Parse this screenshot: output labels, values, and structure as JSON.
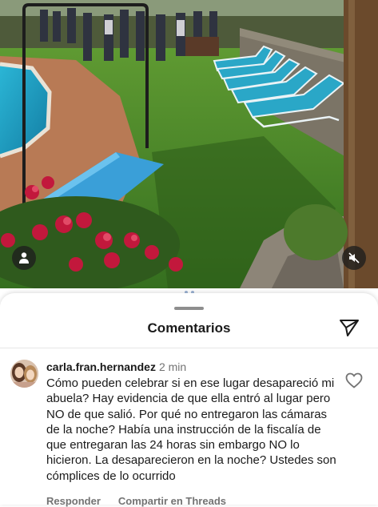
{
  "sheet": {
    "title": "Comentarios"
  },
  "comment": {
    "username": "carla.fran.hernandez",
    "time": "2 min",
    "text": "Cómo pueden celebrar si en ese lugar desapareció mi abuela? Hay evidencia de que ella entró al lugar pero NO de que salió. Por qué no entregaron las cámaras de la noche? Había una instrucción de la fiscalía de que entregaran las 24 horas sin embargo NO lo hicieron. La desaparecieron en la noche? Ustedes son cómplices de lo ocurrido",
    "reply_label": "Responder",
    "share_threads_label": "Compartir en Threads"
  },
  "icons": {
    "user_tag": "person-icon",
    "mute": "speaker-muted-icon",
    "share": "paper-plane-icon",
    "like": "heart-icon"
  },
  "colors": {
    "accent_text": "#1a1a1a",
    "muted_text": "#737373",
    "pool_water": "#1f9fc4",
    "lawn": "#3f7f25"
  }
}
